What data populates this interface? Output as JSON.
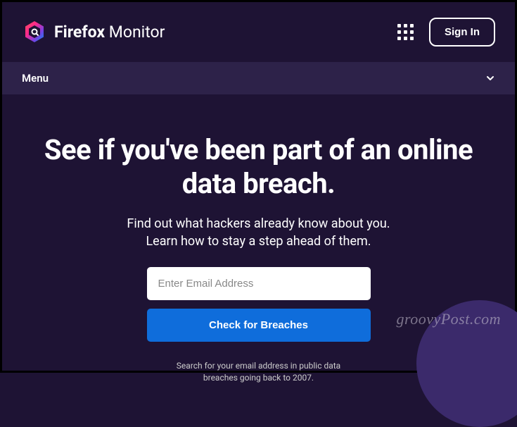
{
  "header": {
    "brand_bold": "Firefox",
    "brand_light": "Monitor",
    "signin_label": "Sign In"
  },
  "menu": {
    "label": "Menu"
  },
  "hero": {
    "title": "See if you've been part of an online data breach.",
    "subtitle_line1": "Find out what hackers already know about you.",
    "subtitle_line2": "Learn how to stay a step ahead of them."
  },
  "form": {
    "email_placeholder": "Enter Email Address",
    "check_label": "Check for Breaches",
    "footer_line1": "Search for your email address in public data",
    "footer_line2": "breaches going back to 2007."
  },
  "watermark": "groovyPost.com"
}
